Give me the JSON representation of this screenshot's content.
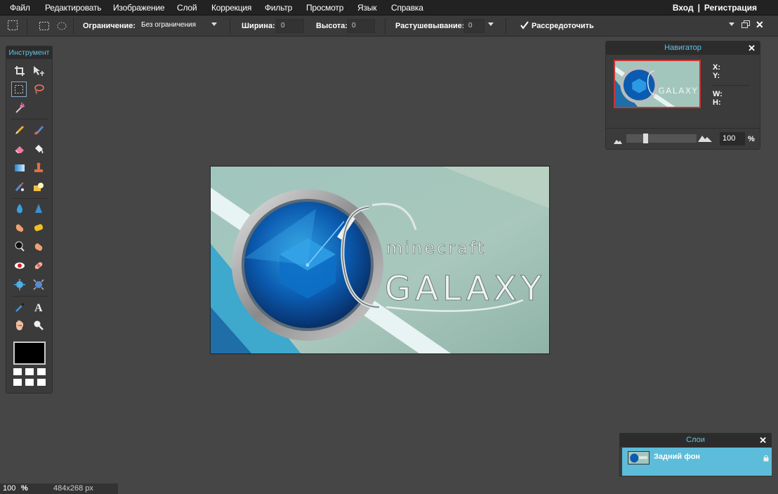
{
  "menu": {
    "items": [
      "Файл",
      "Редактировать",
      "Изображение",
      "Слой",
      "Коррекция",
      "Фильтр",
      "Просмотр",
      "Язык",
      "Справка"
    ],
    "login": "Вход",
    "separator": "|",
    "register": "Регистрация"
  },
  "options": {
    "constraint_label": "Ограничение:",
    "constraint_value": "Без ограничения",
    "width_label": "Ширина:",
    "width_value": "0",
    "height_label": "Высота:",
    "height_value": "0",
    "feather_label": "Растушевывание:",
    "feather_value": "0",
    "antialias_label": "Рассредоточить",
    "antialias_checked": true
  },
  "tools": {
    "title": "Инструмент",
    "foreground_color": "#000000"
  },
  "canvas": {
    "title_small": "minecraft",
    "title_big": "GALAXY"
  },
  "navigator": {
    "title": "Навигатор",
    "x_label": "X:",
    "y_label": "Y:",
    "w_label": "W:",
    "h_label": "H:",
    "zoom_value": "100",
    "zoom_unit": "%"
  },
  "layers": {
    "title": "Слои",
    "layer_name": "Задний фон"
  },
  "status": {
    "zoom": "100",
    "zoom_unit": "%",
    "size": "484x268 px"
  },
  "colors": {
    "accent": "#60c4ea",
    "layer_selected": "#5cbcd9",
    "panel_bg": "#3b3b3b",
    "workspace_bg": "#464646"
  }
}
